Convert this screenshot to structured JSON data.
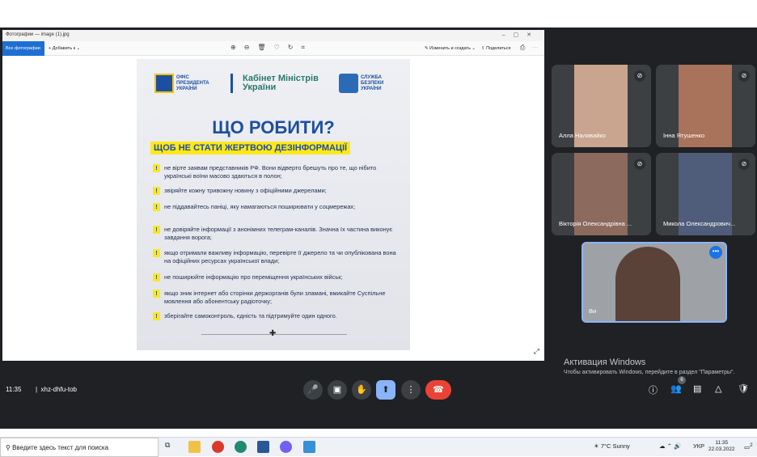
{
  "photos_app": {
    "window_title": "Фотографии — image (1).jpg",
    "all_photos": "Все фотографии",
    "add": "Добавить к",
    "edit_create": "Изменить и создать",
    "share": "Поделиться"
  },
  "poster": {
    "logo1": "ОФІС ПРЕЗИДЕНТА УКРАЇНИ",
    "logo2": "Кабінет Міністрів України",
    "logo3": "СЛУЖБА БЕЗПЕКИ УКРАЇНИ",
    "title": "ЩО РОБИТИ?",
    "subtitle": "ЩОБ НЕ СТАТИ ЖЕРТВОЮ ДЕЗІНФОРМАЦІЇ",
    "tips": [
      "не вірте заявам представників РФ. Вони відверто брешуть про те, що нібито українські воїни масово здаються в полон;",
      "звіряйте кожну тривожну новину з офіційними джерелами;",
      "не піддавайтесь паніці, яку намагаються поширювати у соцмережах;",
      "не довіряйте інформації з анонімних телеграм-каналів. Значна їх частина виконує завдання ворога;",
      "якщо отримали важливу інформацію, перевірте її джерело та чи опублікована вона на офіційних ресурсах української влади;",
      "не поширюйте інформацію про переміщення українських військ;",
      "якщо зник інтернет або сторінки держорганів були зламані, вмикайте Суспільне мовлення або абонентську радіоточку;",
      "зберігайте самоконтроль, єдність та підтримуйте один одного."
    ]
  },
  "participants": [
    {
      "name": "Алла Наливайко"
    },
    {
      "name": "Інна Ятушенко"
    },
    {
      "name": "Вікторія Олександрівна ..."
    },
    {
      "name": "Микола Олександрович..."
    }
  ],
  "self_tile": {
    "name": "Ви"
  },
  "windows_activation": {
    "heading": "Активация Windows",
    "text": "Чтобы активировать Windows, перейдите в раздел \"Параметры\"."
  },
  "meet_bar": {
    "time": "11:35",
    "separator": "|",
    "code": "xhz-dhfu-tob",
    "people_count": "6"
  },
  "taskbar": {
    "search_placeholder": "Введите здесь текст для поиска",
    "weather": "7°C  Sunny",
    "lang": "УКР",
    "time": "11:35",
    "date": "22.03.2022",
    "notif_count": "2"
  }
}
